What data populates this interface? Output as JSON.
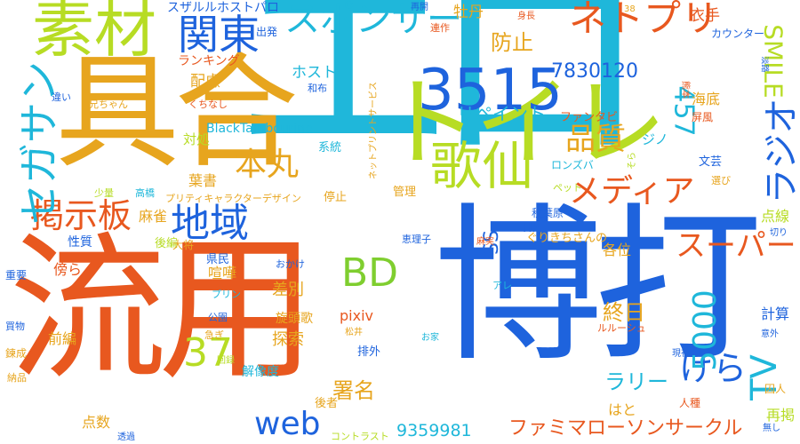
{
  "cloud": {
    "colors": {
      "cyan": "#1fb7da",
      "blue": "#1e63dd",
      "orange": "#e8581f",
      "gold": "#e7a51e",
      "lime": "#b7dc24",
      "green": "#7fce2f"
    },
    "words": [
      {
        "text": "エロ",
        "color": "cyan"
      },
      {
        "text": "博打",
        "color": "blue"
      },
      {
        "text": "流用",
        "color": "orange"
      },
      {
        "text": "具合",
        "color": "gold"
      },
      {
        "text": "トイレ",
        "color": "lime"
      },
      {
        "text": "素材",
        "color": "lime"
      },
      {
        "text": "関東",
        "color": "blue"
      },
      {
        "text": "スポンサー",
        "color": "cyan"
      },
      {
        "text": "ネトプリ",
        "color": "orange"
      },
      {
        "text": "3515",
        "color": "blue"
      },
      {
        "text": "歌仙",
        "color": "lime"
      },
      {
        "text": "地域",
        "color": "blue"
      },
      {
        "text": "掲示板",
        "color": "orange"
      },
      {
        "text": "セガサン",
        "color": "cyan"
      },
      {
        "text": "BD",
        "color": "green"
      },
      {
        "text": "本丸",
        "color": "gold"
      },
      {
        "text": "メディア",
        "color": "orange"
      },
      {
        "text": "品質",
        "color": "gold"
      },
      {
        "text": "スーパー",
        "color": "orange"
      },
      {
        "text": "ラジオ",
        "color": "blue"
      },
      {
        "text": "SMILE",
        "color": "lime"
      },
      {
        "text": "TV",
        "color": "cyan"
      },
      {
        "text": "けら",
        "color": "blue"
      },
      {
        "text": "5000",
        "color": "cyan"
      },
      {
        "text": "web",
        "color": "blue"
      },
      {
        "text": "37",
        "color": "lime"
      },
      {
        "text": "457",
        "color": "cyan"
      },
      {
        "text": "7830120",
        "color": "blue"
      },
      {
        "text": "ファミマローソンサークル",
        "color": "orange"
      },
      {
        "text": "9359981",
        "color": "cyan"
      },
      {
        "text": "リペイント",
        "color": "cyan"
      },
      {
        "text": "防止",
        "color": "gold"
      },
      {
        "text": "SS",
        "color": "blue"
      },
      {
        "text": "終日",
        "color": "gold"
      },
      {
        "text": "ラリー",
        "color": "cyan"
      },
      {
        "text": "署名",
        "color": "gold"
      },
      {
        "text": "探索",
        "color": "gold"
      },
      {
        "text": "差別",
        "color": "gold"
      },
      {
        "text": "pixiv",
        "color": "orange"
      },
      {
        "text": "スザルルホストパロ",
        "color": "blue"
      },
      {
        "text": "ランキング",
        "color": "orange"
      },
      {
        "text": "ホスト",
        "color": "cyan"
      },
      {
        "text": "配慮",
        "color": "gold"
      },
      {
        "text": "BlackTambourine",
        "color": "cyan"
      },
      {
        "text": "対処",
        "color": "lime"
      },
      {
        "text": "葉書",
        "color": "gold"
      },
      {
        "text": "麻雀",
        "color": "gold"
      },
      {
        "text": "後編",
        "color": "lime"
      },
      {
        "text": "喧嘩",
        "color": "gold"
      },
      {
        "text": "傍ら",
        "color": "orange"
      },
      {
        "text": "前編",
        "color": "gold"
      },
      {
        "text": "点数",
        "color": "gold"
      },
      {
        "text": "牡丹",
        "color": "gold"
      },
      {
        "text": "衣手",
        "color": "orange"
      },
      {
        "text": "海底",
        "color": "gold"
      },
      {
        "text": "ジノ",
        "color": "cyan"
      },
      {
        "text": "各位",
        "color": "gold"
      },
      {
        "text": "点線",
        "color": "lime"
      },
      {
        "text": "計算",
        "color": "blue"
      },
      {
        "text": "再掲",
        "color": "lime"
      },
      {
        "text": "はと",
        "color": "gold"
      },
      {
        "text": "HP",
        "color": "blue"
      },
      {
        "text": "旋頭歌",
        "color": "gold"
      },
      {
        "text": "解像度",
        "color": "cyan"
      },
      {
        "text": "後者",
        "color": "gold"
      },
      {
        "text": "排外",
        "color": "blue"
      },
      {
        "text": "ぐりきちさんの",
        "color": "gold"
      },
      {
        "text": "管理",
        "color": "gold"
      },
      {
        "text": "秋葉原",
        "color": "blue"
      },
      {
        "text": "性質",
        "color": "blue"
      },
      {
        "text": "県民",
        "color": "blue"
      },
      {
        "text": "大将",
        "color": "gold"
      },
      {
        "text": "系統",
        "color": "cyan"
      },
      {
        "text": "停止",
        "color": "gold"
      },
      {
        "text": "プリティキャラクターデザイン",
        "color": "gold"
      },
      {
        "text": "ファンタビ",
        "color": "orange"
      },
      {
        "text": "ロンズバ",
        "color": "cyan"
      },
      {
        "text": "ペット",
        "color": "lime"
      },
      {
        "text": "文芸",
        "color": "blue"
      },
      {
        "text": "屏風",
        "color": "orange"
      },
      {
        "text": "選び",
        "color": "gold"
      },
      {
        "text": "カウンター",
        "color": "blue"
      },
      {
        "text": "出発",
        "color": "blue"
      },
      {
        "text": "連作",
        "color": "orange"
      },
      {
        "text": "兄ちゃん",
        "color": "gold"
      },
      {
        "text": "和布",
        "color": "blue"
      },
      {
        "text": "違い",
        "color": "blue"
      },
      {
        "text": "少量",
        "color": "lime"
      },
      {
        "text": "高橋",
        "color": "cyan"
      },
      {
        "text": "くちなし",
        "color": "orange"
      },
      {
        "text": "重要",
        "color": "blue"
      },
      {
        "text": "プリン",
        "color": "cyan"
      },
      {
        "text": "買物",
        "color": "blue"
      },
      {
        "text": "公園",
        "color": "blue"
      },
      {
        "text": "おかけ",
        "color": "blue"
      },
      {
        "text": "急ぎ",
        "color": "gold"
      },
      {
        "text": "鍊成",
        "color": "gold"
      },
      {
        "text": "納品",
        "color": "gold"
      },
      {
        "text": "回録",
        "color": "lime"
      },
      {
        "text": "透過",
        "color": "blue"
      },
      {
        "text": "コントラスト",
        "color": "lime"
      },
      {
        "text": "人種",
        "color": "orange"
      },
      {
        "text": "囚人",
        "color": "gold"
      },
      {
        "text": "意外",
        "color": "blue"
      },
      {
        "text": "無し",
        "color": "blue"
      },
      {
        "text": "現在",
        "color": "blue"
      },
      {
        "text": "ルルーシュ",
        "color": "orange"
      },
      {
        "text": "アレ",
        "color": "cyan"
      },
      {
        "text": "お家",
        "color": "cyan"
      },
      {
        "text": "松井",
        "color": "gold"
      },
      {
        "text": "恵理子",
        "color": "blue"
      },
      {
        "text": "麻実",
        "color": "orange"
      },
      {
        "text": "切り",
        "color": "blue"
      },
      {
        "text": "再開",
        "color": "blue"
      },
      {
        "text": "身長",
        "color": "orange"
      },
      {
        "text": "38",
        "color": "gold"
      },
      {
        "text": "ネットプリントサービス",
        "color": "gold"
      },
      {
        "text": "そら",
        "color": "lime"
      },
      {
        "text": "熊本",
        "color": "orange"
      },
      {
        "text": "淡路",
        "color": "blue"
      }
    ]
  }
}
